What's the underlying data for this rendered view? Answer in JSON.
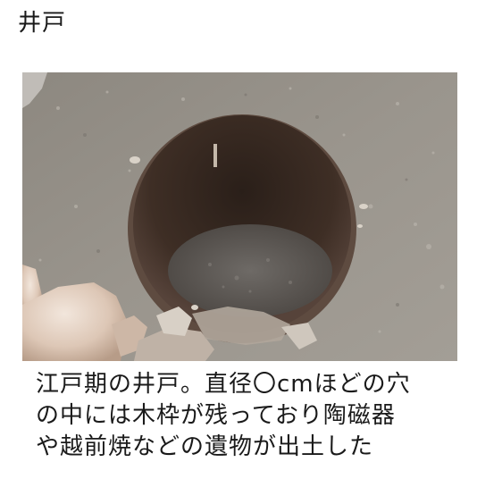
{
  "title": "井戸",
  "caption_lines": [
    "江戸期の井戸。直径〇cmほどの穴",
    "の中には木枠が残っており陶磁器",
    "や越前焼などの遺物が出土した"
  ]
}
